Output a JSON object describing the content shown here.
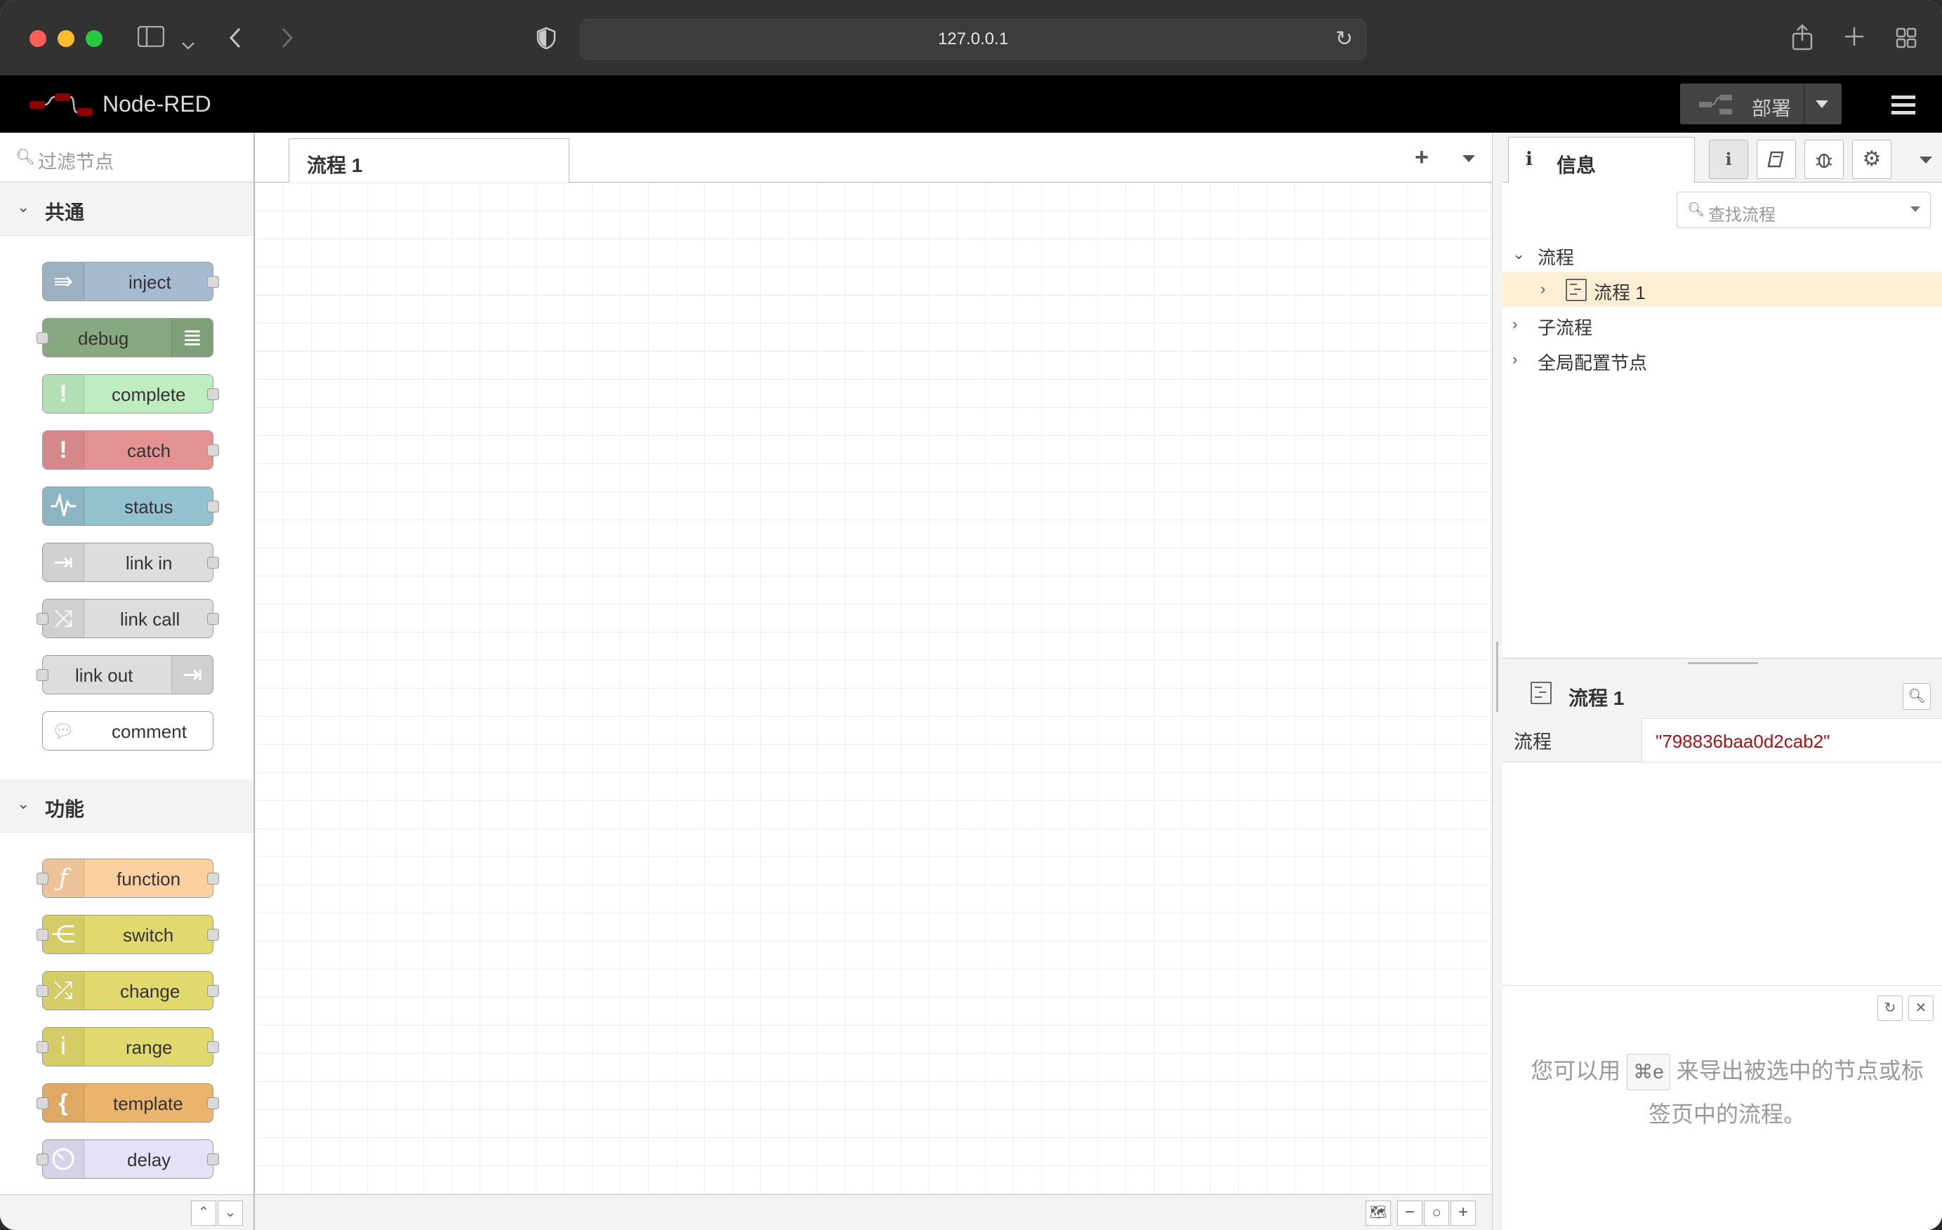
{
  "browser": {
    "url": "127.0.0.1",
    "icons": [
      "sidebar-icon",
      "chevron-down-icon",
      "back-icon",
      "forward-icon",
      "shield-icon",
      "reload-icon",
      "share-icon",
      "new-tab-icon",
      "tab-overview-icon"
    ]
  },
  "header": {
    "title": "Node-RED",
    "deploy_label": "部署"
  },
  "palette": {
    "filter_placeholder": "过滤节点",
    "categories": [
      {
        "label": "共通",
        "nodes": [
          {
            "label": "inject",
            "color": "#a6bbcf"
          },
          {
            "label": "debug",
            "color": "#87a980"
          },
          {
            "label": "complete",
            "color": "#c0edc0"
          },
          {
            "label": "catch",
            "color": "#e49191"
          },
          {
            "label": "status",
            "color": "#94c1d0"
          },
          {
            "label": "link in",
            "color": "#dddddd"
          },
          {
            "label": "link call",
            "color": "#dddddd"
          },
          {
            "label": "link out",
            "color": "#dddddd"
          },
          {
            "label": "comment",
            "color": "#ffffff"
          }
        ]
      },
      {
        "label": "功能",
        "nodes": [
          {
            "label": "function",
            "color": "#fdd0a2"
          },
          {
            "label": "switch",
            "color": "#e2d96e"
          },
          {
            "label": "change",
            "color": "#e2d96e"
          },
          {
            "label": "range",
            "color": "#e2d96e"
          },
          {
            "label": "template",
            "color": "#ebb46c"
          },
          {
            "label": "delay",
            "color": "#e6e0f8"
          }
        ]
      }
    ]
  },
  "workspace": {
    "tab_label": "流程 1"
  },
  "sidebar": {
    "tab_label": "信息",
    "search_placeholder": "查找流程",
    "tree": {
      "flows": "流程",
      "flow1": "流程 1",
      "subflows": "子流程",
      "config": "全局配置节点"
    },
    "props": {
      "title": "流程 1",
      "key": "流程",
      "value": "\"798836baa0d2cab2\""
    },
    "tip": {
      "before": "您可以用",
      "key": "⌘e",
      "after": "来导出被选中的节点或标签页中的流程。"
    }
  }
}
